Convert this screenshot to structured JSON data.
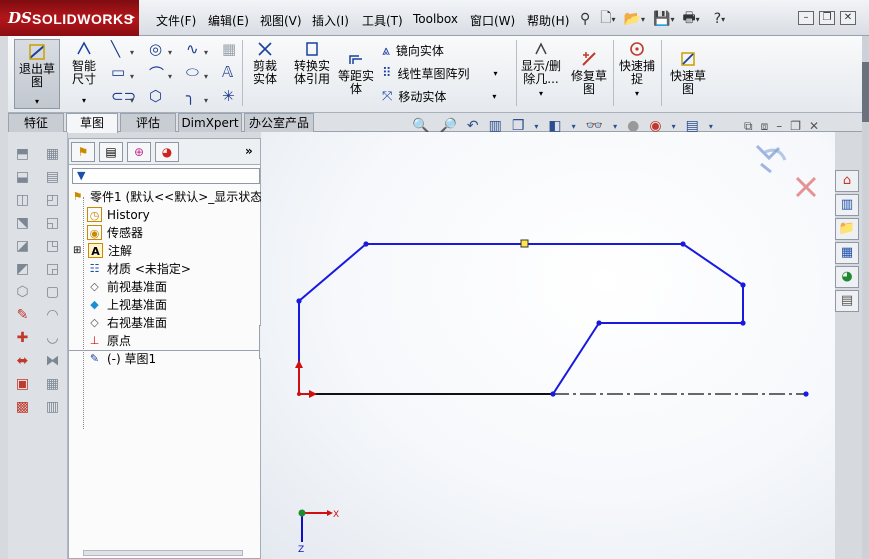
{
  "app": {
    "brand_ds": "DS",
    "brand_name": "SOLIDWORKS"
  },
  "menu": [
    {
      "label": "文件(F)"
    },
    {
      "label": "编辑(E)"
    },
    {
      "label": "视图(V)"
    },
    {
      "label": "插入(I)"
    },
    {
      "label": "工具(T)"
    },
    {
      "label": "Toolbox"
    },
    {
      "label": "窗口(W)"
    },
    {
      "label": "帮助(H)"
    }
  ],
  "ribbon": {
    "exit_sketch": "退出草图",
    "smart_dim": "智能尺寸",
    "trim": "剪裁实体",
    "convert": "转换实体引用",
    "offset": "等距实体",
    "mirror": "镜向实体",
    "linear_pattern": "线性草图阵列",
    "move": "移动实体",
    "show_delete": "显示/删除几...",
    "repair": "修复草图",
    "quick_snap": "快速捕捉",
    "rapid_sketch": "快速草图"
  },
  "tabs": [
    {
      "label": "特征"
    },
    {
      "label": "草图"
    },
    {
      "label": "评估"
    },
    {
      "label": "DimXpert"
    },
    {
      "label": "办公室产品"
    }
  ],
  "tree": {
    "part": "零件1 (默认<<默认>_显示状态",
    "items": [
      {
        "label": "History",
        "icon": "history-icon"
      },
      {
        "label": "传感器",
        "icon": "sensor-icon"
      },
      {
        "label": "注解",
        "icon": "annotation-icon"
      },
      {
        "label": "材质 <未指定>",
        "icon": "material-icon"
      },
      {
        "label": "前视基准面",
        "icon": "plane-icon"
      },
      {
        "label": "上视基准面",
        "icon": "plane-icon"
      },
      {
        "label": "右视基准面",
        "icon": "plane-icon"
      },
      {
        "label": "原点",
        "icon": "origin-icon"
      },
      {
        "label": "(-) 草图1",
        "icon": "sketch-icon"
      }
    ]
  },
  "colors": {
    "sketch_line": "#1a1adf",
    "origin_red": "#d01010",
    "brand_red": "#b3161b"
  }
}
